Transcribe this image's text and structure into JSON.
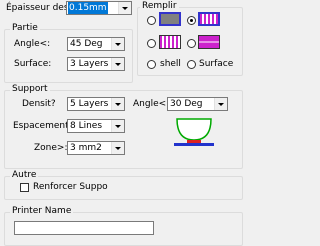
{
  "epaisseur": {
    "label": "Épaisseur des",
    "value": "0.15mm"
  },
  "partie": {
    "title": "Partie",
    "angle_label": "Angle<:",
    "angle_value": "45 Deg",
    "surface_label": "Surface:",
    "surface_value": "3 Layers"
  },
  "remplir": {
    "title": "Remplir",
    "shell_label": "shell",
    "surface_label": "Surface",
    "accent": "#cc22cc"
  },
  "support": {
    "title": "Support",
    "densite_label": "Densit?",
    "densite_value": "5 Layers",
    "angle_label": "Angle<:",
    "angle_value": "30 Deg",
    "espacement_label": "Espacement :",
    "espacement_value": "8 Lines",
    "zone_label": "Zone>:",
    "zone_value": "3 mm2"
  },
  "autre": {
    "title": "Autre",
    "renforcer_label": "Renforcer Suppo"
  },
  "printer": {
    "title": "Printer Name",
    "value": ""
  }
}
